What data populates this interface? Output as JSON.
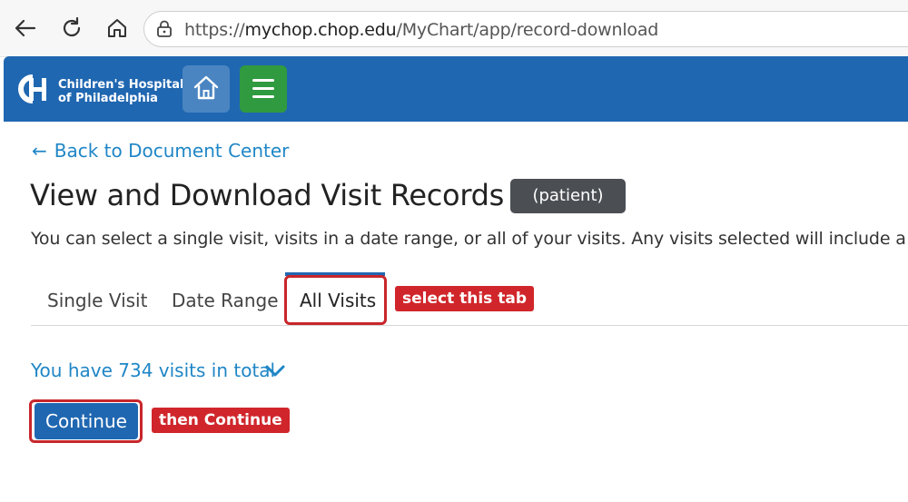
{
  "browser": {
    "url_scheme": "https://",
    "url_host": "mychop.chop.edu",
    "url_path": "/MyChart/app/record-download",
    "back_icon": "back-arrow-icon",
    "reload_icon": "reload-icon",
    "home_icon": "home-icon"
  },
  "header": {
    "logo_line1": "Children's Hospital",
    "logo_line2": "of Philadelphia",
    "home_icon": "home-icon",
    "menu_icon": "hamburger-menu-icon",
    "colors": {
      "bar": "#2067b1",
      "home_btn": "#4a85c2",
      "menu_btn": "#2f9a3f"
    }
  },
  "content": {
    "back_link": "Back to Document Center",
    "title": "View and Download Visit Records (",
    "patient_tag": "(patient)",
    "description": "You can select a single visit, visits in a date range, or all of your visits. Any visits selected will include a co",
    "tabs": [
      {
        "label": "Single Visit",
        "active": false
      },
      {
        "label": "Date Range",
        "active": false
      },
      {
        "label": "All Visits",
        "active": true
      }
    ],
    "visits_summary": "You have 734 visits in total",
    "continue_label": "Continue"
  },
  "annotations": {
    "tab_callout": "select this tab",
    "continue_callout": "then Continue",
    "color": "#c8262b"
  }
}
